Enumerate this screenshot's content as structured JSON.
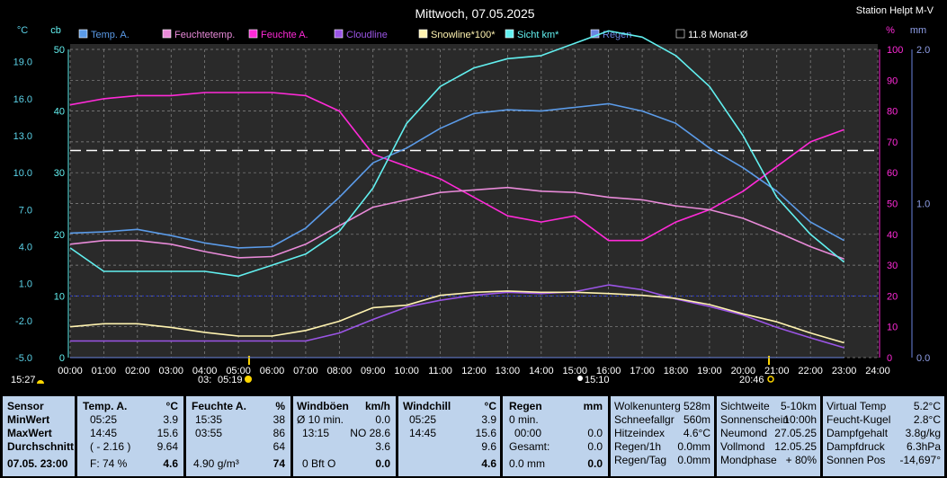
{
  "header": {
    "title": "Mittwoch, 07.05.2025",
    "station": "Station Helpt M-V"
  },
  "units": {
    "temp": "°C",
    "cb": "cb",
    "pct": "%",
    "mm": "mm"
  },
  "legend": [
    {
      "label": "Temp. A.",
      "color": "#5b9be8"
    },
    {
      "label": "Feuchtetemp.",
      "color": "#e88ad8"
    },
    {
      "label": "Feuchte A.",
      "color": "#ff2ad8"
    },
    {
      "label": "Cloudline",
      "color": "#9b55e6"
    },
    {
      "label": "Snowline*100*",
      "color": "#fff3b0"
    },
    {
      "label": "Sicht km*",
      "color": "#62f0f0"
    },
    {
      "label": "Regen",
      "color": "#6b85e0"
    },
    {
      "label": "11.8 Monat-Ø",
      "color": "#ffffff"
    }
  ],
  "axes": {
    "temp_ticks": [
      "19.0",
      "16.0",
      "13.0",
      "10.0",
      "7.0",
      "4.0",
      "1.0",
      "-2.0",
      "-5.0"
    ],
    "cb_ticks": [
      "50",
      "40",
      "30",
      "20",
      "10",
      "0"
    ],
    "pct_ticks": [
      "100",
      "90",
      "80",
      "70",
      "60",
      "50",
      "40",
      "30",
      "20",
      "10",
      "0"
    ],
    "mm_ticks": [
      "2.0",
      "1.0",
      "0.0"
    ],
    "time_ticks": [
      "00:00",
      "01:00",
      "02:00",
      "03:00",
      "04:00",
      "05:00",
      "06:00",
      "07:00",
      "08:00",
      "09:00",
      "10:00",
      "11:00",
      "12:00",
      "13:00",
      "14:00",
      "15:00",
      "16:00",
      "17:00",
      "18:00",
      "19:00",
      "20:00",
      "21:00",
      "22:00",
      "23:00",
      "24:00"
    ]
  },
  "markers": {
    "now": "15:27",
    "dawn": "03:",
    "sunrise": "05:19",
    "moon": "15:10",
    "sunset": "20:46"
  },
  "chart_data": {
    "type": "line",
    "title": "Mittwoch, 07.05.2025",
    "x_range": [
      "00:00",
      "24:00"
    ],
    "ylim_temp": [
      -5,
      20
    ],
    "ylim_cb": [
      0,
      50
    ],
    "ylim_pct": [
      0,
      100
    ],
    "ylim_mm": [
      0,
      2
    ],
    "grid": true,
    "legend_position": "top",
    "hours": [
      0,
      1,
      2,
      3,
      4,
      5,
      6,
      7,
      8,
      9,
      10,
      11,
      12,
      13,
      14,
      15,
      16,
      17,
      18,
      19,
      20,
      21,
      22,
      23
    ],
    "series": [
      {
        "name": "Temp. A.",
        "axis": "temp",
        "color": "#5b9be8",
        "values": [
          5.1,
          5.2,
          5.4,
          4.9,
          4.3,
          3.9,
          4.0,
          5.5,
          8.0,
          10.8,
          12.0,
          13.6,
          14.8,
          15.1,
          15.0,
          15.3,
          15.6,
          15.0,
          14.0,
          12.0,
          10.4,
          8.5,
          6.0,
          4.5
        ]
      },
      {
        "name": "Feuchtetemp.",
        "axis": "temp",
        "color": "#e88ad8",
        "values": [
          4.2,
          4.5,
          4.5,
          4.2,
          3.6,
          3.1,
          3.2,
          4.2,
          5.7,
          7.2,
          7.8,
          8.4,
          8.6,
          8.8,
          8.5,
          8.4,
          8.0,
          7.8,
          7.3,
          7.0,
          6.3,
          5.2,
          4.0,
          3.0
        ]
      },
      {
        "name": "Feuchte A.",
        "axis": "pct",
        "color": "#ff2ad8",
        "values": [
          82,
          84,
          85,
          85,
          86,
          86,
          86,
          85,
          80,
          66,
          62,
          58,
          52,
          46,
          44,
          46,
          38,
          38,
          44,
          48,
          54,
          62,
          70,
          74
        ]
      },
      {
        "name": "Cloudline",
        "axis": "cb",
        "color": "#9b55e6",
        "values": [
          2.7,
          2.7,
          2.7,
          2.7,
          2.7,
          2.7,
          2.7,
          2.7,
          4.0,
          6.2,
          8.2,
          9.3,
          10.1,
          10.6,
          10.4,
          10.7,
          11.8,
          11.0,
          9.5,
          8.3,
          6.9,
          4.9,
          3.2,
          1.6
        ]
      },
      {
        "name": "Snowline*100*",
        "axis": "cb",
        "color": "#fff3b0",
        "values": [
          5.0,
          5.5,
          5.5,
          4.9,
          4.1,
          3.5,
          3.5,
          4.4,
          5.9,
          8.1,
          8.5,
          10.1,
          10.6,
          10.8,
          10.6,
          10.6,
          10.4,
          10.1,
          9.6,
          8.6,
          7.1,
          5.8,
          4.0,
          2.4
        ]
      },
      {
        "name": "Sicht km*",
        "axis": "cb",
        "color": "#62f0f0",
        "values": [
          17.8,
          14.0,
          14.0,
          14.0,
          14.0,
          13.2,
          15.0,
          16.8,
          20.5,
          27.5,
          38.0,
          44.0,
          47.0,
          48.5,
          49.0,
          51.0,
          53.0,
          52.0,
          49.0,
          44.0,
          36.0,
          26.0,
          20.0,
          15.5
        ]
      },
      {
        "name": "Regen",
        "axis": "mm",
        "color": "#6b85e0",
        "values": [
          0,
          0,
          0,
          0,
          0,
          0,
          0,
          0,
          0,
          0,
          0,
          0,
          0,
          0,
          0,
          0,
          0,
          0,
          0,
          0,
          0,
          0,
          0,
          0
        ]
      }
    ],
    "reference_line": {
      "name": "11.8 Monat-Ø",
      "axis": "temp",
      "value": 11.8
    }
  },
  "stats": {
    "labels": {
      "sensor": "Sensor",
      "min": "MinWert",
      "max": "MaxWert",
      "avg": "Durchschnitt",
      "date": "07.05. 23:00"
    },
    "temp": {
      "title": "Temp. A.",
      "unit": "°C",
      "min_time": "05:25",
      "min_val": "3.9",
      "max_time": "14:45",
      "max_val": "15.6",
      "avg_paren": "( - 2.16 )",
      "avg_val": "9.64",
      "last_label": "F: 74 %",
      "last_val": "4.6"
    },
    "hum": {
      "title": "Feuchte A.",
      "unit": "%",
      "min_time": "15:35",
      "min_val": "38",
      "max_time": "03:55",
      "max_val": "86",
      "avg_val": "64",
      "last_label": "4.90 g/m³",
      "last_val": "74"
    },
    "wind": {
      "title": "Windböen",
      "unit": "km/h",
      "min_time": "Ø 10 min.",
      "min_val": "0.0",
      "max_time": "13:15",
      "max_dir": "NO 28.6",
      "avg_val": "3.6",
      "last_label": "0 Bft O",
      "last_val": "0.0"
    },
    "chill": {
      "title": "Windchill",
      "unit": "°C",
      "min_time": "05:25",
      "min_val": "3.9",
      "max_time": "14:45",
      "max_val": "15.6",
      "avg_val": "9.6",
      "last_val": "4.6"
    },
    "rain": {
      "title": "Regen",
      "unit": "mm",
      "r1_label": "0 min.",
      "r2_label": "00:00",
      "r2_val": "0.0",
      "r3_label": "Gesamt:",
      "r3_val": "0.0",
      "r4_label": "0.0 mm",
      "r4_val": "0.0"
    },
    "misc1": [
      {
        "label": "Wolkenunterg",
        "value": "528m"
      },
      {
        "label": "Schneefallgr",
        "value": "560m"
      },
      {
        "label": "Hitzeindex",
        "value": "4.6°C"
      },
      {
        "label": "Regen/1h",
        "value": "0.0mm"
      },
      {
        "label": "Regen/Tag",
        "value": "0.0mm"
      }
    ],
    "misc2": [
      {
        "label": "Sichtweite",
        "value": "5-10km"
      },
      {
        "label": "Sonnenschein",
        "value": "10:00h"
      },
      {
        "label": "Neumond",
        "value": "27.05.25"
      },
      {
        "label": "Vollmond",
        "value": "12.05.25"
      },
      {
        "label": "Mondphase",
        "value": "+ 80%"
      }
    ],
    "misc3": [
      {
        "label": "Virtual Temp",
        "value": "5.2°C"
      },
      {
        "label": "Feucht-Kugel",
        "value": "2.8°C"
      },
      {
        "label": "Dampfgehalt",
        "value": "3.8g/kg"
      },
      {
        "label": "Dampfdruck",
        "value": "6.3hPa"
      },
      {
        "label": "Sonnen Pos",
        "value": "-14,697°"
      }
    ]
  }
}
